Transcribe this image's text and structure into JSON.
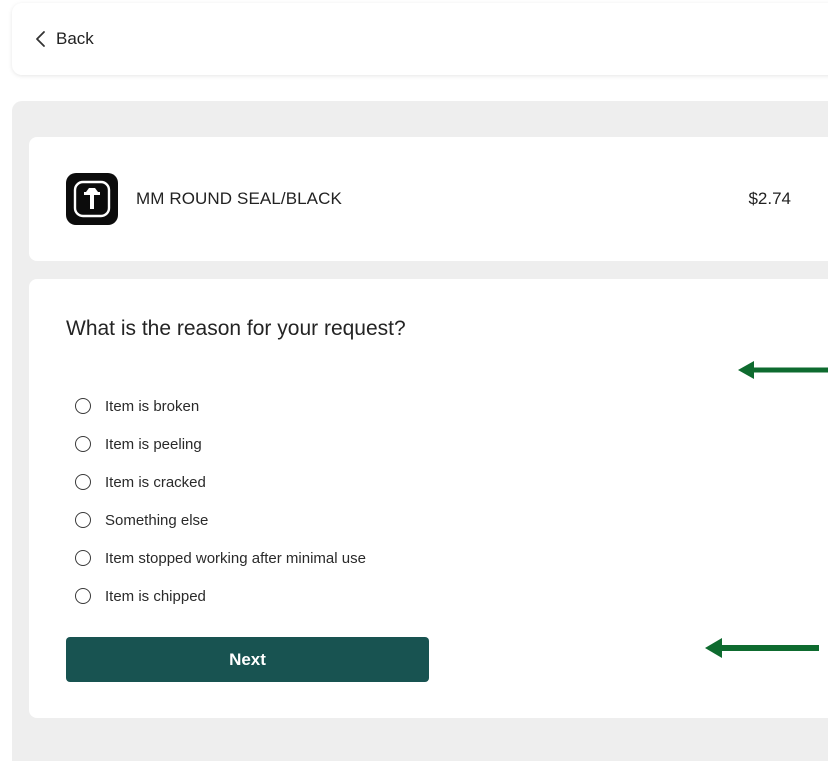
{
  "header": {
    "back_label": "Back"
  },
  "product": {
    "name": "MM ROUND SEAL/BLACK",
    "price": "$2.74",
    "logo_icon": "brand-logo-icon"
  },
  "reason": {
    "question": "What is the reason for your request?",
    "options": [
      {
        "label": "Item is broken"
      },
      {
        "label": "Item is peeling"
      },
      {
        "label": "Item is cracked"
      },
      {
        "label": "Something else"
      },
      {
        "label": "Item stopped working after minimal use"
      },
      {
        "label": "Item is chipped"
      }
    ],
    "next_label": "Next"
  },
  "colors": {
    "primary_button": "#185351",
    "annotation_arrow": "#0e6b2f",
    "panel_background": "#eeeeee"
  }
}
